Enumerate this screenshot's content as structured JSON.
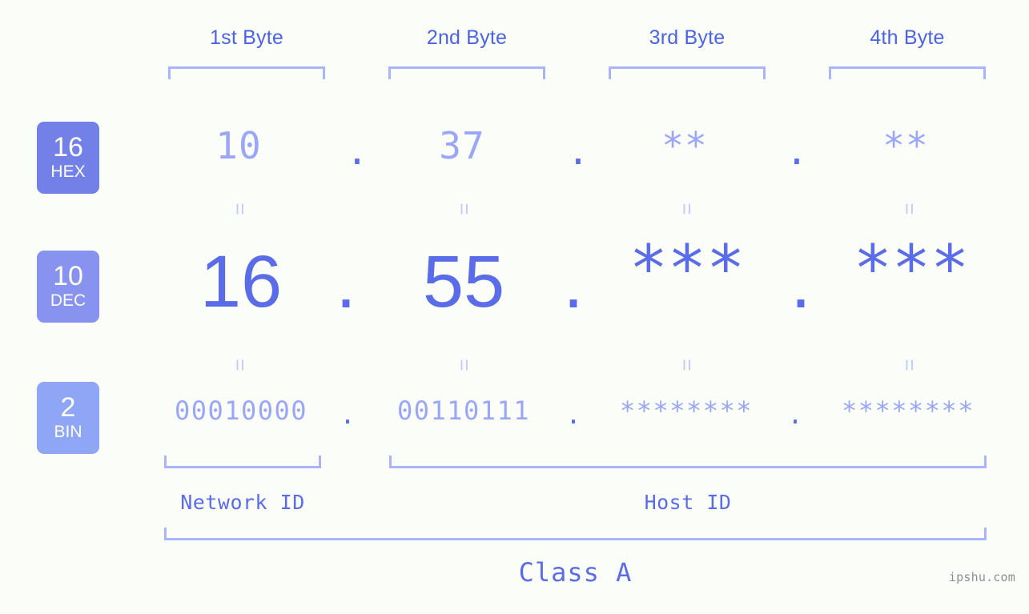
{
  "headers": [
    {
      "label": "1st Byte"
    },
    {
      "label": "2nd Byte"
    },
    {
      "label": "3rd Byte"
    },
    {
      "label": "4th Byte"
    }
  ],
  "badges": [
    {
      "base": "16",
      "system": "HEX",
      "color": "#7280e8"
    },
    {
      "base": "10",
      "system": "DEC",
      "color": "#8893f0"
    },
    {
      "base": "2",
      "system": "BIN",
      "color": "#8fa5f6"
    }
  ],
  "rows": {
    "hex": {
      "system": "HEX",
      "values": [
        "10",
        "37",
        "**",
        "**"
      ],
      "separator": "."
    },
    "dec": {
      "system": "DEC",
      "values": [
        "16",
        "55",
        "***",
        "***"
      ],
      "separator": "."
    },
    "bin": {
      "system": "BIN",
      "values": [
        "00010000",
        "00110111",
        "********",
        "********"
      ],
      "separator": "."
    }
  },
  "equals": {
    "glyph": "="
  },
  "zones": [
    {
      "label": "Network ID"
    },
    {
      "label": "Host ID"
    }
  ],
  "class": {
    "label": "Class A"
  },
  "watermark": {
    "text": "ipshu.com"
  },
  "colors": {
    "background": "#fbfdf8",
    "accent_strong": "#5a6ce8",
    "accent_mid": "#9aa6f7",
    "accent_light": "#a9b4fb",
    "header_text": "#4a63e7",
    "watermark": "#8d8d99"
  }
}
